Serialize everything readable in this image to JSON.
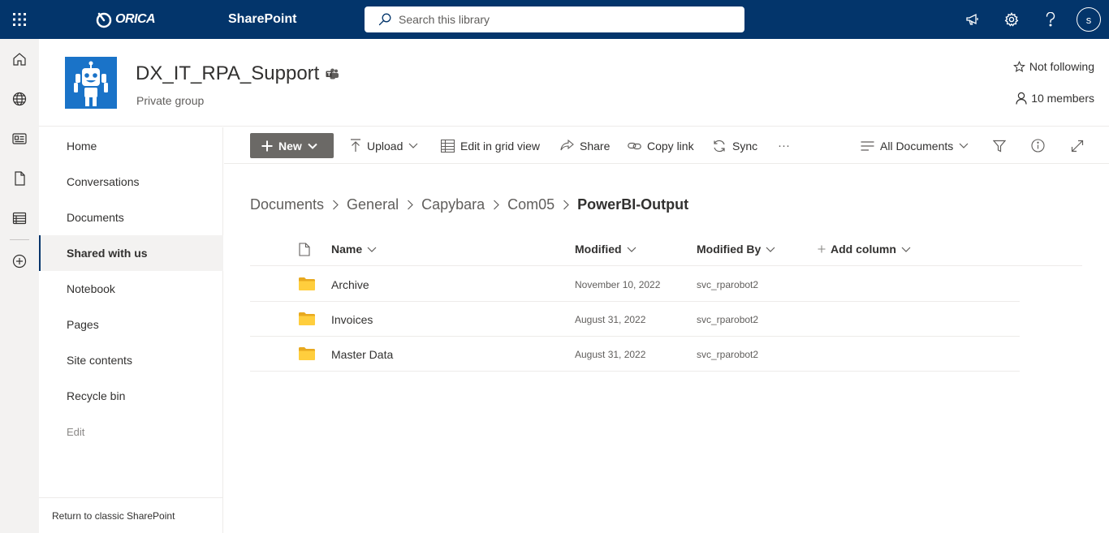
{
  "suite_bar": {
    "brand": "ORICA",
    "app_name": "SharePoint",
    "search_placeholder": "Search this library",
    "avatar_initial": "s",
    "icons": [
      "waffle-icon",
      "megaphone-icon",
      "gear-icon",
      "help-icon"
    ],
    "background": "#03356b"
  },
  "app_bar": {
    "icons": [
      "home-icon",
      "globe-icon",
      "news-icon",
      "file-icon",
      "lists-icon",
      "create-icon"
    ]
  },
  "site": {
    "title": "DX_IT_RPA_Support",
    "subtitle": "Private group",
    "follow_label": "Not following",
    "members_label": "10 members",
    "logo_color": "#1a73c8"
  },
  "nav": {
    "items": [
      {
        "label": "Home",
        "active": false
      },
      {
        "label": "Conversations",
        "active": false
      },
      {
        "label": "Documents",
        "active": false
      },
      {
        "label": "Shared with us",
        "active": true
      },
      {
        "label": "Notebook",
        "active": false
      },
      {
        "label": "Pages",
        "active": false
      },
      {
        "label": "Site contents",
        "active": false
      },
      {
        "label": "Recycle bin",
        "active": false
      }
    ],
    "edit_label": "Edit",
    "classic_label": "Return to classic SharePoint"
  },
  "commands": {
    "new_label": "New",
    "upload_label": "Upload",
    "grid_label": "Edit in grid view",
    "share_label": "Share",
    "copylink_label": "Copy link",
    "sync_label": "Sync",
    "more_label": "···",
    "view_label": "All Documents"
  },
  "breadcrumb": {
    "items": [
      "Documents",
      "General",
      "Capybara",
      "Com05"
    ],
    "current": "PowerBI-Output"
  },
  "list": {
    "columns": {
      "name": "Name",
      "modified": "Modified",
      "modified_by": "Modified By",
      "add_column": "Add column"
    },
    "rows": [
      {
        "name": "Archive",
        "modified": "November 10, 2022",
        "modified_by": "svc_rparobot2"
      },
      {
        "name": "Invoices",
        "modified": "August 31, 2022",
        "modified_by": "svc_rparobot2"
      },
      {
        "name": "Master Data",
        "modified": "August 31, 2022",
        "modified_by": "svc_rparobot2"
      }
    ],
    "folder_color": "#ffce3d"
  }
}
